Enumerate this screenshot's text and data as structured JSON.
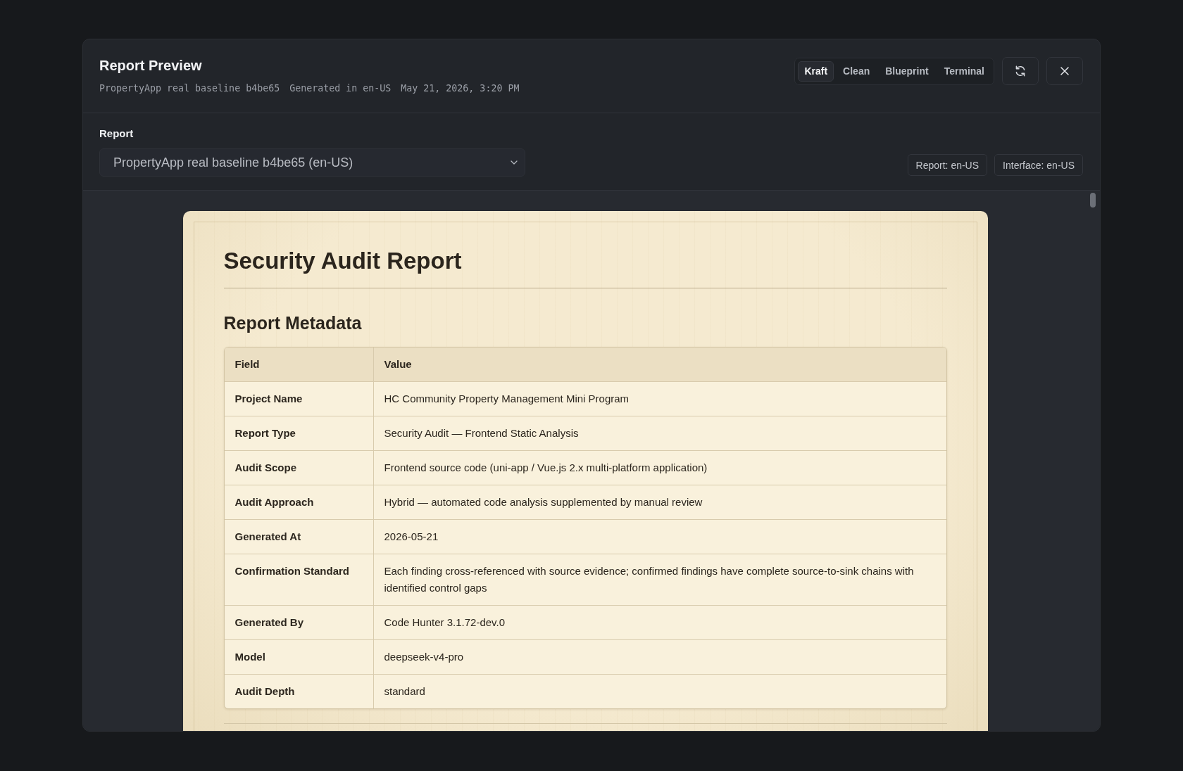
{
  "dialog": {
    "title": "Report Preview",
    "meta": [
      "PropertyApp real baseline b4be65",
      "Generated in en-US",
      "May 21, 2026, 3:20 PM"
    ],
    "theme_tabs": [
      {
        "label": "Kraft",
        "selected": true
      },
      {
        "label": "Clean",
        "selected": false
      },
      {
        "label": "Blueprint",
        "selected": false
      },
      {
        "label": "Terminal",
        "selected": false
      }
    ]
  },
  "report_picker": {
    "label": "Report",
    "value": "PropertyApp real baseline b4be65 (en-US)"
  },
  "locale_tags": [
    "Report: en-US",
    "Interface: en-US"
  ],
  "document": {
    "title": "Security Audit Report",
    "section": "Report Metadata",
    "table": {
      "columns": [
        "Field",
        "Value"
      ],
      "rows": [
        {
          "field": "Project Name",
          "value": "HC Community Property Management Mini Program"
        },
        {
          "field": "Report Type",
          "value": "Security Audit — Frontend Static Analysis"
        },
        {
          "field": "Audit Scope",
          "value": "Frontend source code (uni-app / Vue.js 2.x multi-platform application)"
        },
        {
          "field": "Audit Approach",
          "value": "Hybrid — automated code analysis supplemented by manual review"
        },
        {
          "field": "Generated At",
          "value": "2026-05-21"
        },
        {
          "field": "Confirmation Standard",
          "value": "Each finding cross-referenced with source evidence; confirmed findings have complete source-to-sink chains with identified control gaps"
        },
        {
          "field": "Generated By",
          "value": "Code Hunter 3.1.72-dev.0"
        },
        {
          "field": "Model",
          "value": "deepseek-v4-pro"
        },
        {
          "field": "Audit Depth",
          "value": "standard"
        }
      ]
    }
  }
}
